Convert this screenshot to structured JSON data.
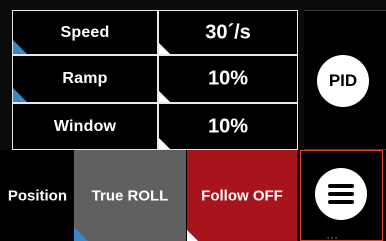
{
  "settings": {
    "rows": [
      {
        "label": "Speed",
        "value": "30´/s"
      },
      {
        "label": "Ramp",
        "value": "10%"
      },
      {
        "label": "Window",
        "value": "10%"
      }
    ]
  },
  "side_panel": {
    "pid_label": "PID"
  },
  "bottom_bar": {
    "position_label": "Position",
    "true_roll_label": "True ROLL",
    "follow_label": "Follow OFF",
    "menu_icon": "hamburger-menu-icon"
  },
  "colors": {
    "background": "#000000",
    "border": "#e8e8e8",
    "true_roll_bg": "#606060",
    "follow_bg": "#a8141b",
    "menu_border": "#e0452f",
    "corner_blue": "#3b86c8"
  }
}
